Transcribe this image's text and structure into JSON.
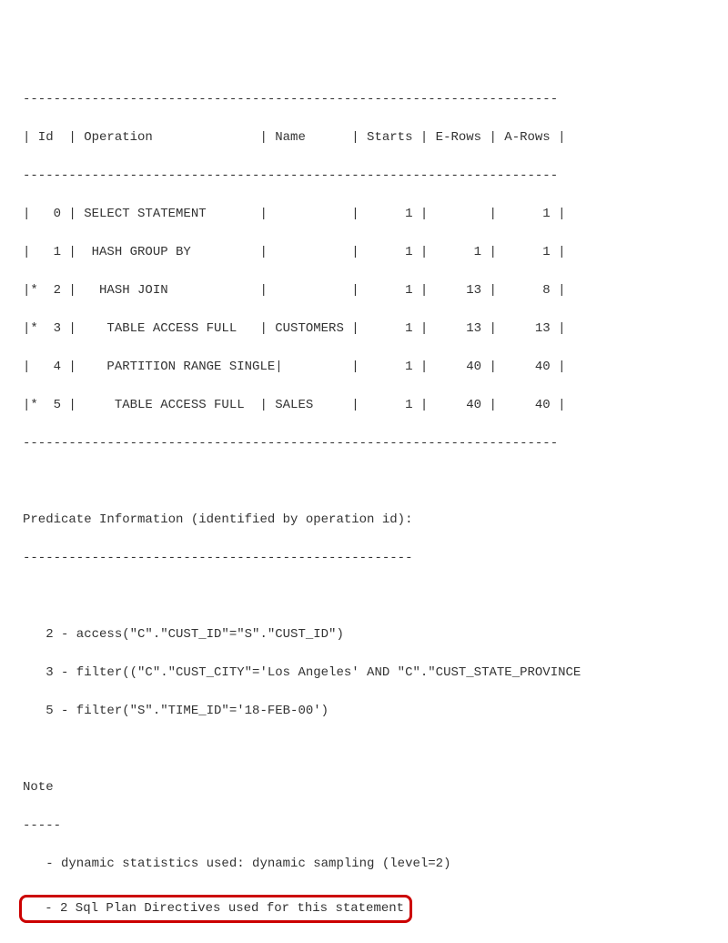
{
  "plan_table": {
    "header_sep": "----------------------------------------------------------------------",
    "header": "| Id  | Operation              | Name      | Starts | E-Rows | A-Rows |",
    "rows": [
      "|   0 | SELECT STATEMENT       |           |      1 |        |      1 |",
      "|   1 |  HASH GROUP BY         |           |      1 |      1 |      1 |",
      "|*  2 |   HASH JOIN            |           |      1 |     13 |      8 |",
      "|*  3 |    TABLE ACCESS FULL   | CUSTOMERS |      1 |     13 |     13 |",
      "|   4 |    PARTITION RANGE SINGLE|         |      1 |     40 |     40 |",
      "|*  5 |     TABLE ACCESS FULL  | SALES     |      1 |     40 |     40 |"
    ]
  },
  "predicate": {
    "title": "Predicate Information (identified by operation id):",
    "sep": "---------------------------------------------------",
    "lines": [
      "   2 - access(\"C\".\"CUST_ID\"=\"S\".\"CUST_ID\")",
      "   3 - filter((\"C\".\"CUST_CITY\"='Los Angeles' AND \"C\".\"CUST_STATE_PROVINCE",
      "   5 - filter(\"S\".\"TIME_ID\"='18-FEB-00')"
    ]
  },
  "note": {
    "title": "Note",
    "sep": "-----",
    "lines": [
      "   - dynamic statistics used: dynamic sampling (level=2)"
    ],
    "highlighted": "   - 2 Sql Plan Directives used for this statement"
  }
}
